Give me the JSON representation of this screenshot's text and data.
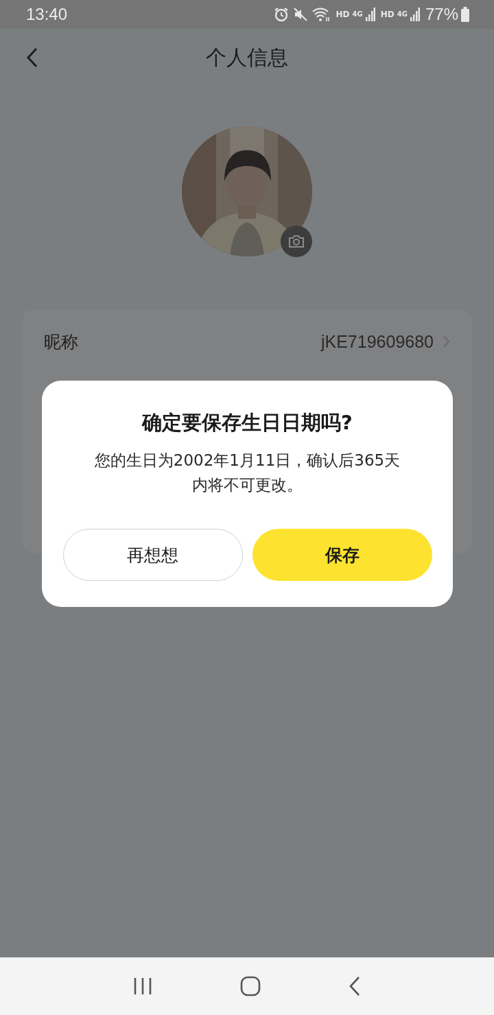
{
  "status_bar": {
    "time": "13:40",
    "networks": [
      {
        "hd": "HD",
        "gen": "4G"
      },
      {
        "hd": "HD",
        "gen": "4G"
      }
    ],
    "battery": "77%"
  },
  "header": {
    "title": "个人信息"
  },
  "fields": [
    {
      "label": "昵称",
      "value": "jKE719609680"
    }
  ],
  "dialog": {
    "title": "确定要保存生日日期吗?",
    "message": "您的生日为2002年1月11日，确认后365天内将不可更改。",
    "buttons": [
      {
        "label": "再想想",
        "kind": "secondary"
      },
      {
        "label": "保存",
        "kind": "primary"
      }
    ]
  }
}
